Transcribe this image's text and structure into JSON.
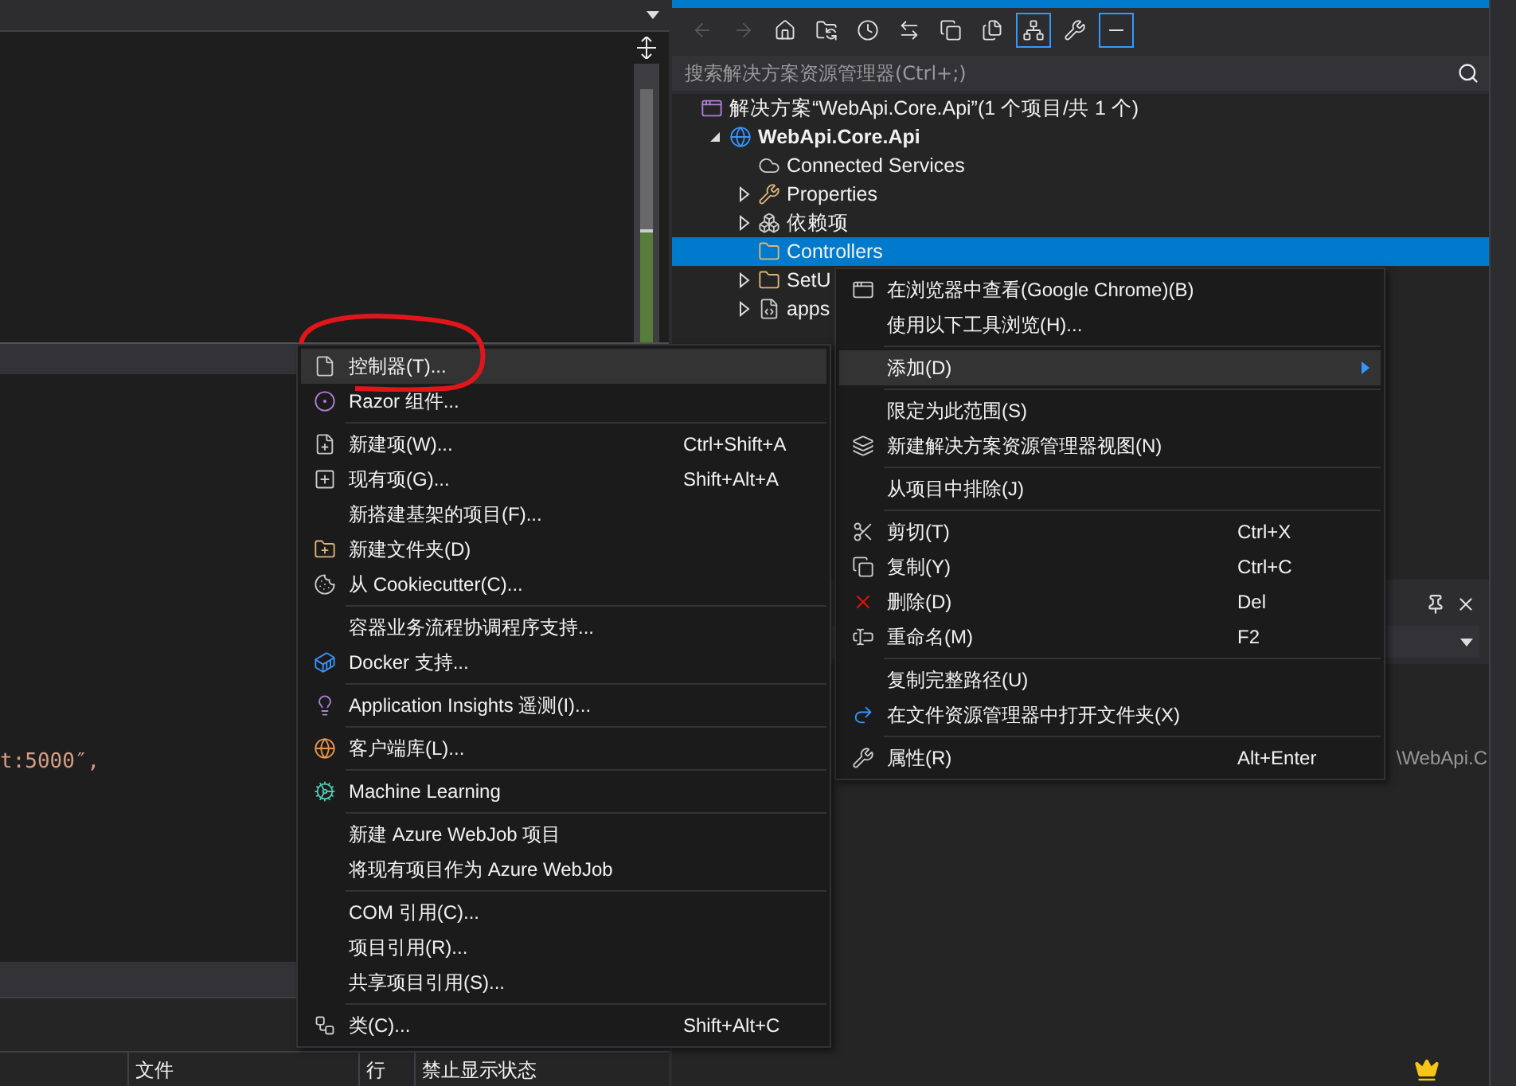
{
  "editor": {
    "code_fragment": "t:5000″,"
  },
  "error_list": {
    "columns": [
      "文件",
      "行",
      "禁止显示状态"
    ]
  },
  "solution_explorer": {
    "toolbar": [
      {
        "kind": "back",
        "disabled": true
      },
      {
        "kind": "forward",
        "disabled": true
      },
      {
        "kind": "home",
        "disabled": false
      },
      {
        "kind": "sync",
        "disabled": false
      },
      {
        "kind": "history",
        "disabled": false
      },
      {
        "kind": "switch",
        "disabled": false
      },
      {
        "kind": "collapse",
        "disabled": false
      },
      {
        "kind": "pages",
        "disabled": false
      },
      {
        "kind": "tree",
        "disabled": false,
        "on": true
      },
      {
        "kind": "wrench",
        "disabled": false
      },
      {
        "kind": "preview",
        "disabled": false,
        "on": true
      }
    ],
    "search": {
      "placeholder": "搜索解决方案资源管理器(Ctrl+;)"
    },
    "tree": [
      {
        "kind": "solution",
        "label": "解决方案“WebApi.Core.Api”(1 个项目/共 1 个)",
        "selected": false,
        "children": [
          {
            "kind": "project",
            "label": "WebApi.Core.Api",
            "selected": false,
            "expanded": true,
            "children": [
              {
                "kind": "connected",
                "label": "Connected Services",
                "selected": false
              },
              {
                "kind": "properties",
                "label": "Properties",
                "selected": false,
                "expanded": false
              },
              {
                "kind": "dependencies",
                "label": "依赖项",
                "selected": false,
                "expanded": false
              },
              {
                "kind": "folder",
                "label": "Controllers",
                "selected": true
              },
              {
                "kind": "folder",
                "label": "SetU",
                "selected": false,
                "expanded": false
              },
              {
                "kind": "file",
                "label": "apps",
                "selected": false,
                "expanded": false
              }
            ]
          }
        ]
      }
    ]
  },
  "properties_panel": {
    "path_fragment": "\\WebApi.C"
  },
  "context_menu": {
    "groups": [
      [
        {
          "label": "在浏览器中查看(Google Chrome)(B)",
          "selected": false
        },
        {
          "label": "使用以下工具浏览(H)...",
          "selected": false
        }
      ],
      [
        {
          "label": "添加(D)",
          "selected": true,
          "submenu": true
        }
      ],
      [
        {
          "label": "限定为此范围(S)",
          "selected": false
        },
        {
          "label": "新建解决方案资源管理器视图(N)",
          "selected": false
        }
      ],
      [
        {
          "label": "从项目中排除(J)",
          "selected": false
        }
      ],
      [
        {
          "label": "剪切(T)",
          "shortcut": "Ctrl+X",
          "selected": false
        },
        {
          "label": "复制(Y)",
          "shortcut": "Ctrl+C",
          "selected": false
        },
        {
          "label": "删除(D)",
          "shortcut": "Del",
          "selected": false
        },
        {
          "label": "重命名(M)",
          "shortcut": "F2",
          "selected": false
        }
      ],
      [
        {
          "label": "复制完整路径(U)",
          "selected": false
        },
        {
          "label": "在文件资源管理器中打开文件夹(X)",
          "selected": false
        }
      ],
      [
        {
          "label": "属性(R)",
          "shortcut": "Alt+Enter",
          "selected": false
        }
      ]
    ]
  },
  "add_submenu": {
    "groups": [
      [
        {
          "label": "控制器(T)...",
          "selected": true
        },
        {
          "label": "Razor 组件...",
          "selected": false
        }
      ],
      [
        {
          "label": "新建项(W)...",
          "shortcut": "Ctrl+Shift+A",
          "selected": false
        },
        {
          "label": "现有项(G)...",
          "shortcut": "Shift+Alt+A",
          "selected": false
        },
        {
          "label": "新搭建基架的项目(F)...",
          "selected": false
        },
        {
          "label": "新建文件夹(D)",
          "selected": false
        },
        {
          "label": "从 Cookiecutter(C)...",
          "selected": false
        }
      ],
      [
        {
          "label": "容器业务流程协调程序支持...",
          "selected": false
        },
        {
          "label": "Docker 支持...",
          "selected": false
        }
      ],
      [
        {
          "label": "Application Insights 遥测(I)...",
          "selected": false
        }
      ],
      [
        {
          "label": "客户端库(L)...",
          "selected": false
        }
      ],
      [
        {
          "label": "Machine Learning",
          "selected": false
        }
      ],
      [
        {
          "label": "新建 Azure WebJob 项目",
          "selected": false
        },
        {
          "label": "将现有项目作为 Azure WebJob",
          "selected": false
        }
      ],
      [
        {
          "label": "COM 引用(C)...",
          "selected": false
        },
        {
          "label": "项目引用(R)...",
          "selected": false
        },
        {
          "label": "共享项目引用(S)...",
          "selected": false
        }
      ],
      [
        {
          "label": "类(C)...",
          "shortcut": "Shift+Alt+C",
          "selected": false
        }
      ]
    ]
  }
}
